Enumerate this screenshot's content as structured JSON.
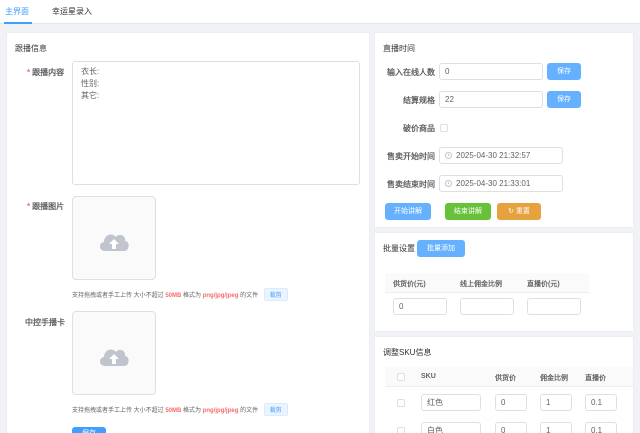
{
  "tabs": [
    {
      "label": "主界面",
      "active": true
    },
    {
      "label": "幸运星录入",
      "active": false
    }
  ],
  "left": {
    "title": "跟播信息",
    "content_label": "跟播内容",
    "content_value": "衣长:\n性别:\n其它:",
    "images_label": "跟播图片",
    "card_label": "中控手播卡",
    "hint_prefix": "支持拖拽或者手工上传 大小不超过",
    "hint_size": "50MB",
    "hint_mid": "格式为",
    "hint_formats": "png/jpg/jpeg",
    "hint_suffix": "的文件",
    "crop_label": "裁剪",
    "bottom_button": "保存"
  },
  "live": {
    "title": "直播时间",
    "online_label": "输入在线人数",
    "online_value": "0",
    "online_save": "保存",
    "spec_label": "结算规格",
    "spec_value": "22",
    "spec_save": "保存",
    "broken_label": "破价商品",
    "start_label": "售卖开始时间",
    "start_value": "2025-04-30 21:32:57",
    "end_label": "售卖结束时间",
    "end_value": "2025-04-30 21:33:01",
    "start_btn": "开始讲解",
    "end_btn": "结束讲解",
    "reset_btn": "重置"
  },
  "batch": {
    "title": "批量设置",
    "add_btn": "批量添加",
    "columns": [
      "供货价(元)",
      "线上佣金比例",
      "直播价(元)"
    ],
    "values": [
      "0",
      "",
      ""
    ]
  },
  "sku": {
    "title": "调整SKU信息",
    "columns": [
      "SKU",
      "供货价",
      "佣金比例",
      "直播价"
    ],
    "rows": [
      {
        "sku": "红色",
        "supply": "0",
        "ratio": "1",
        "price": "0.1"
      },
      {
        "sku": "白色",
        "supply": "0",
        "ratio": "1",
        "price": "0.1"
      }
    ]
  },
  "colors": {
    "primary": "#409eff",
    "success": "#67c23a",
    "warning": "#e6a23c",
    "danger": "#f56c6c"
  }
}
